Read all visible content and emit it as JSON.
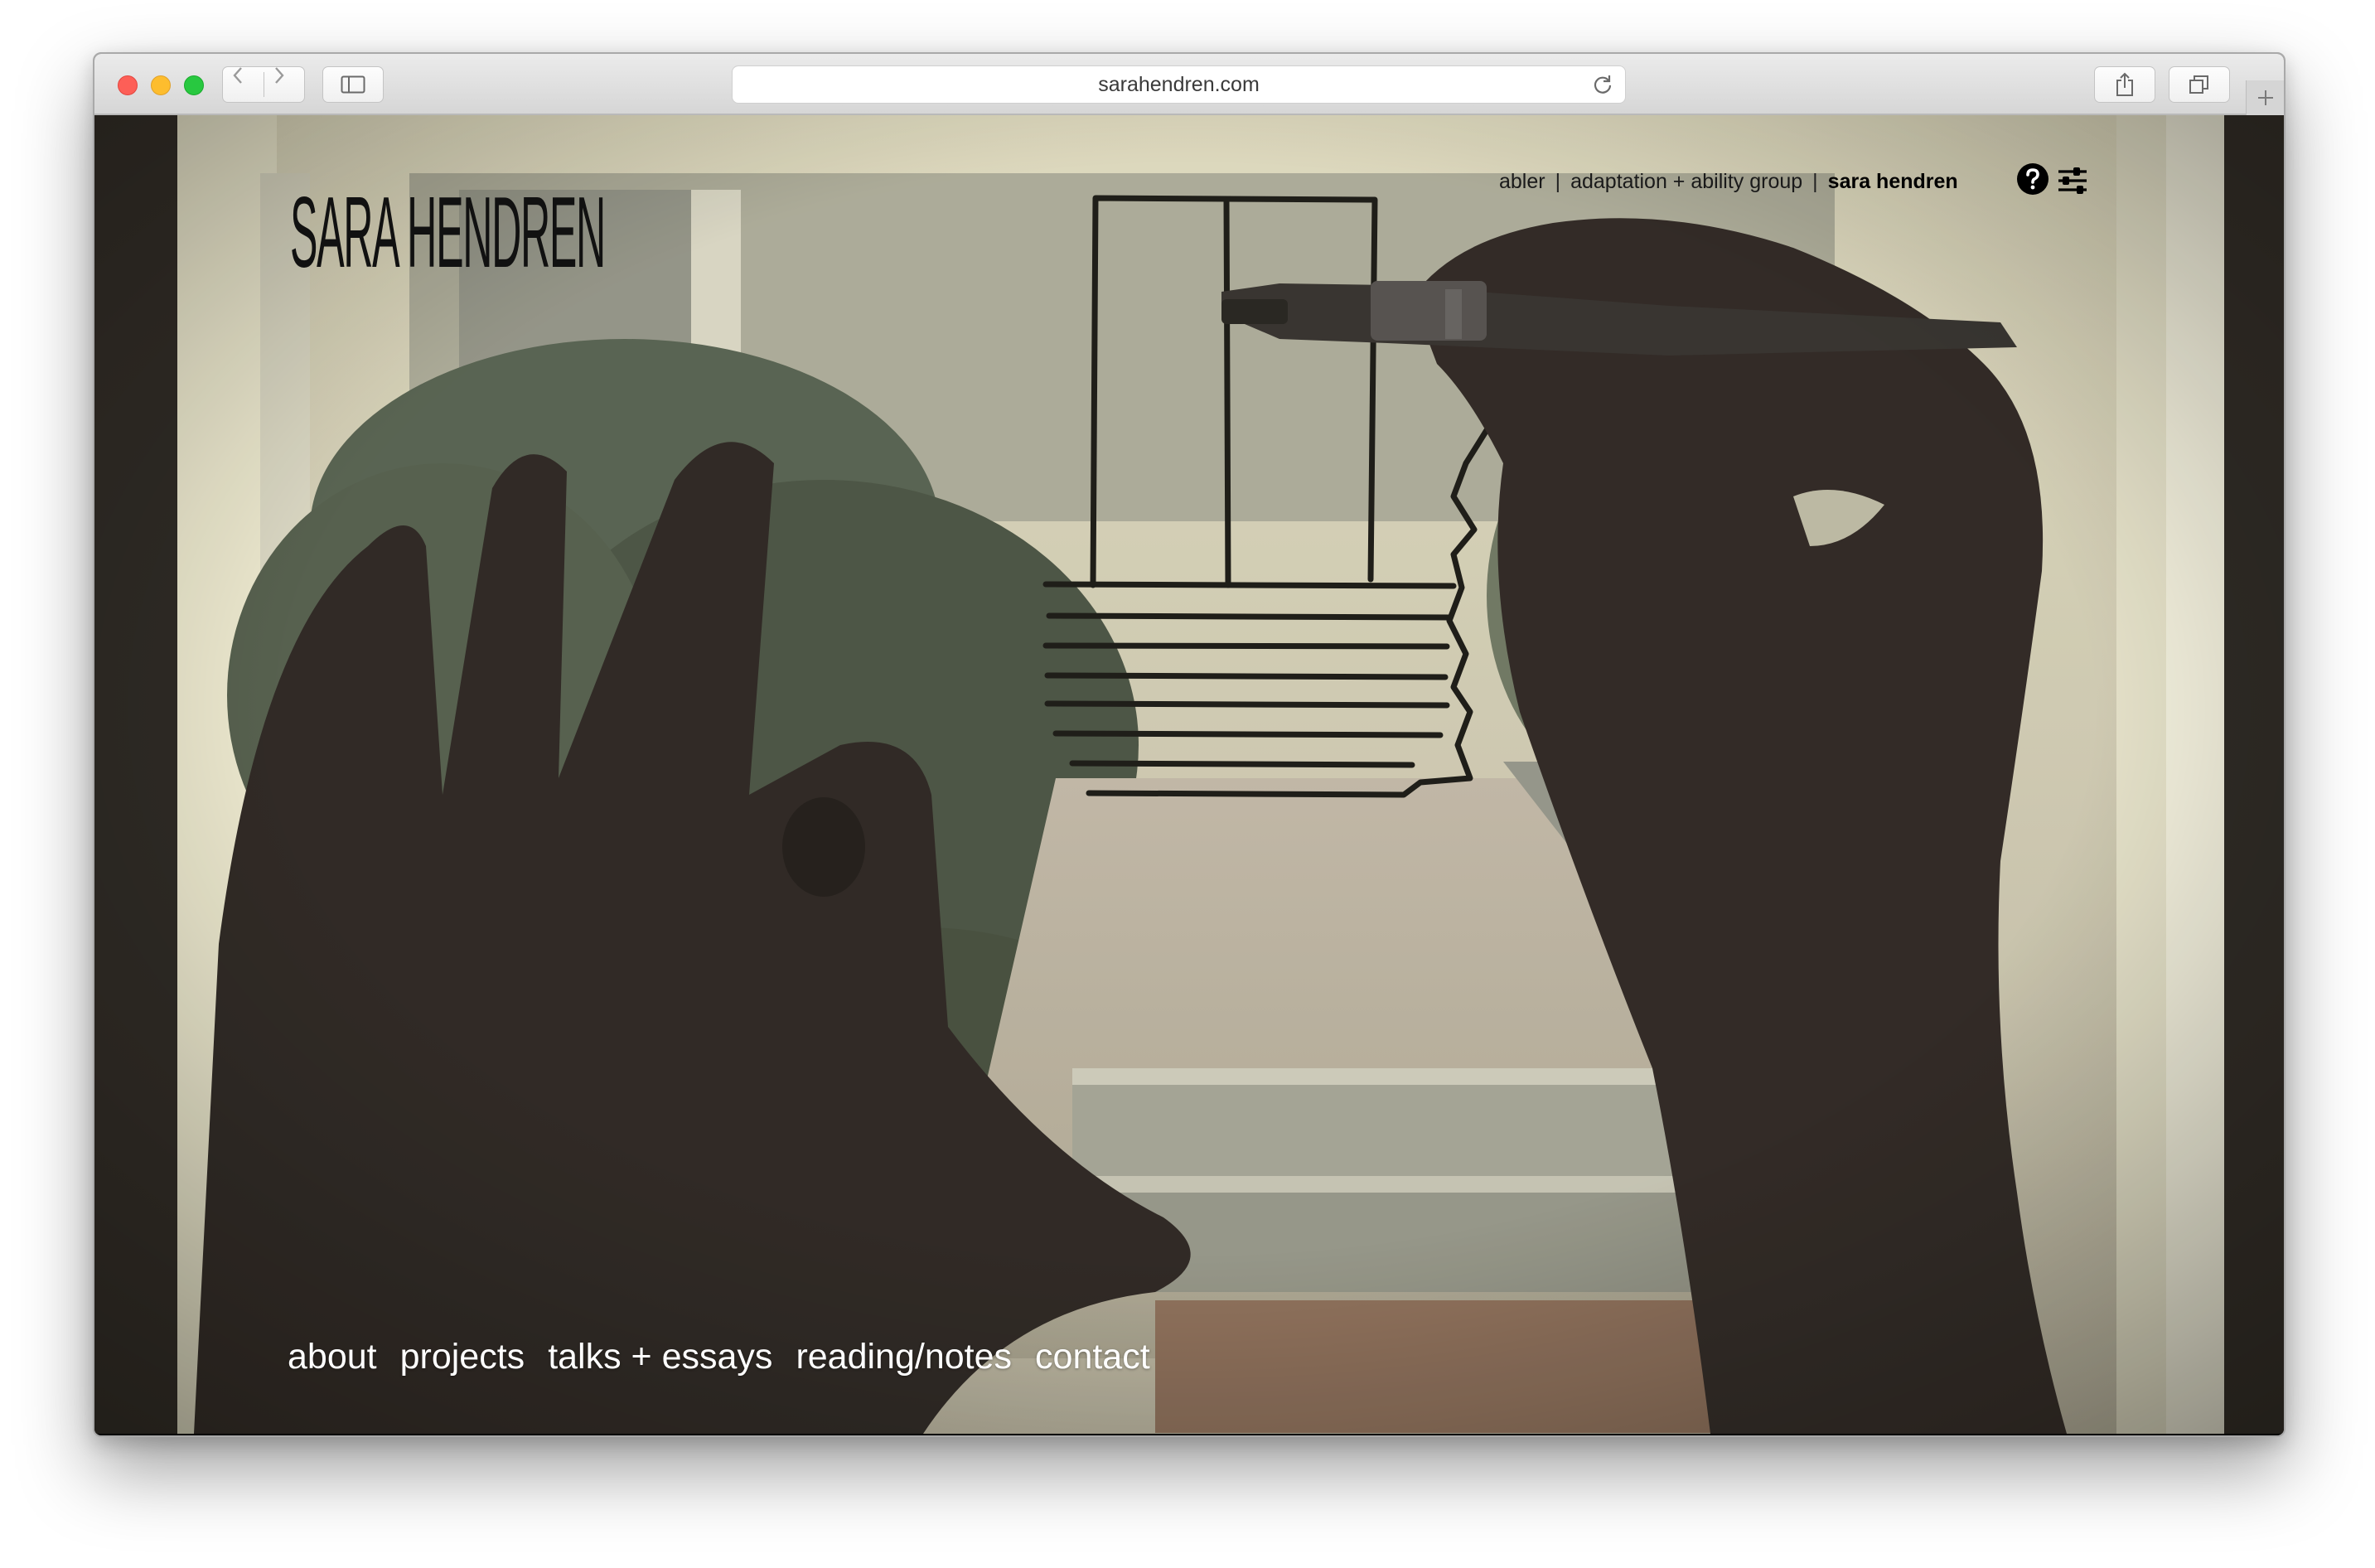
{
  "browser": {
    "url": "sarahendren.com",
    "icons": {
      "back": "chevron-left-icon",
      "forward": "chevron-right-icon",
      "sidebar": "sidebar-icon",
      "reload": "reload-icon",
      "share": "share-icon",
      "tabs": "tabs-overview-icon",
      "new_tab": "plus-icon"
    }
  },
  "site": {
    "logo": "SARA HENDREN",
    "top_nav": [
      {
        "label": "abler",
        "current": false
      },
      {
        "label": "adaptation + ability group",
        "current": false
      },
      {
        "label": "sara hendren",
        "current": true
      }
    ],
    "top_nav_separator": "|",
    "icons": {
      "help": "help-circle-icon",
      "settings": "sliders-icon"
    },
    "bottom_nav": [
      "about",
      "projects",
      "talks + essays",
      "reading/notes",
      "contact"
    ],
    "hero_image": "hero-image"
  }
}
